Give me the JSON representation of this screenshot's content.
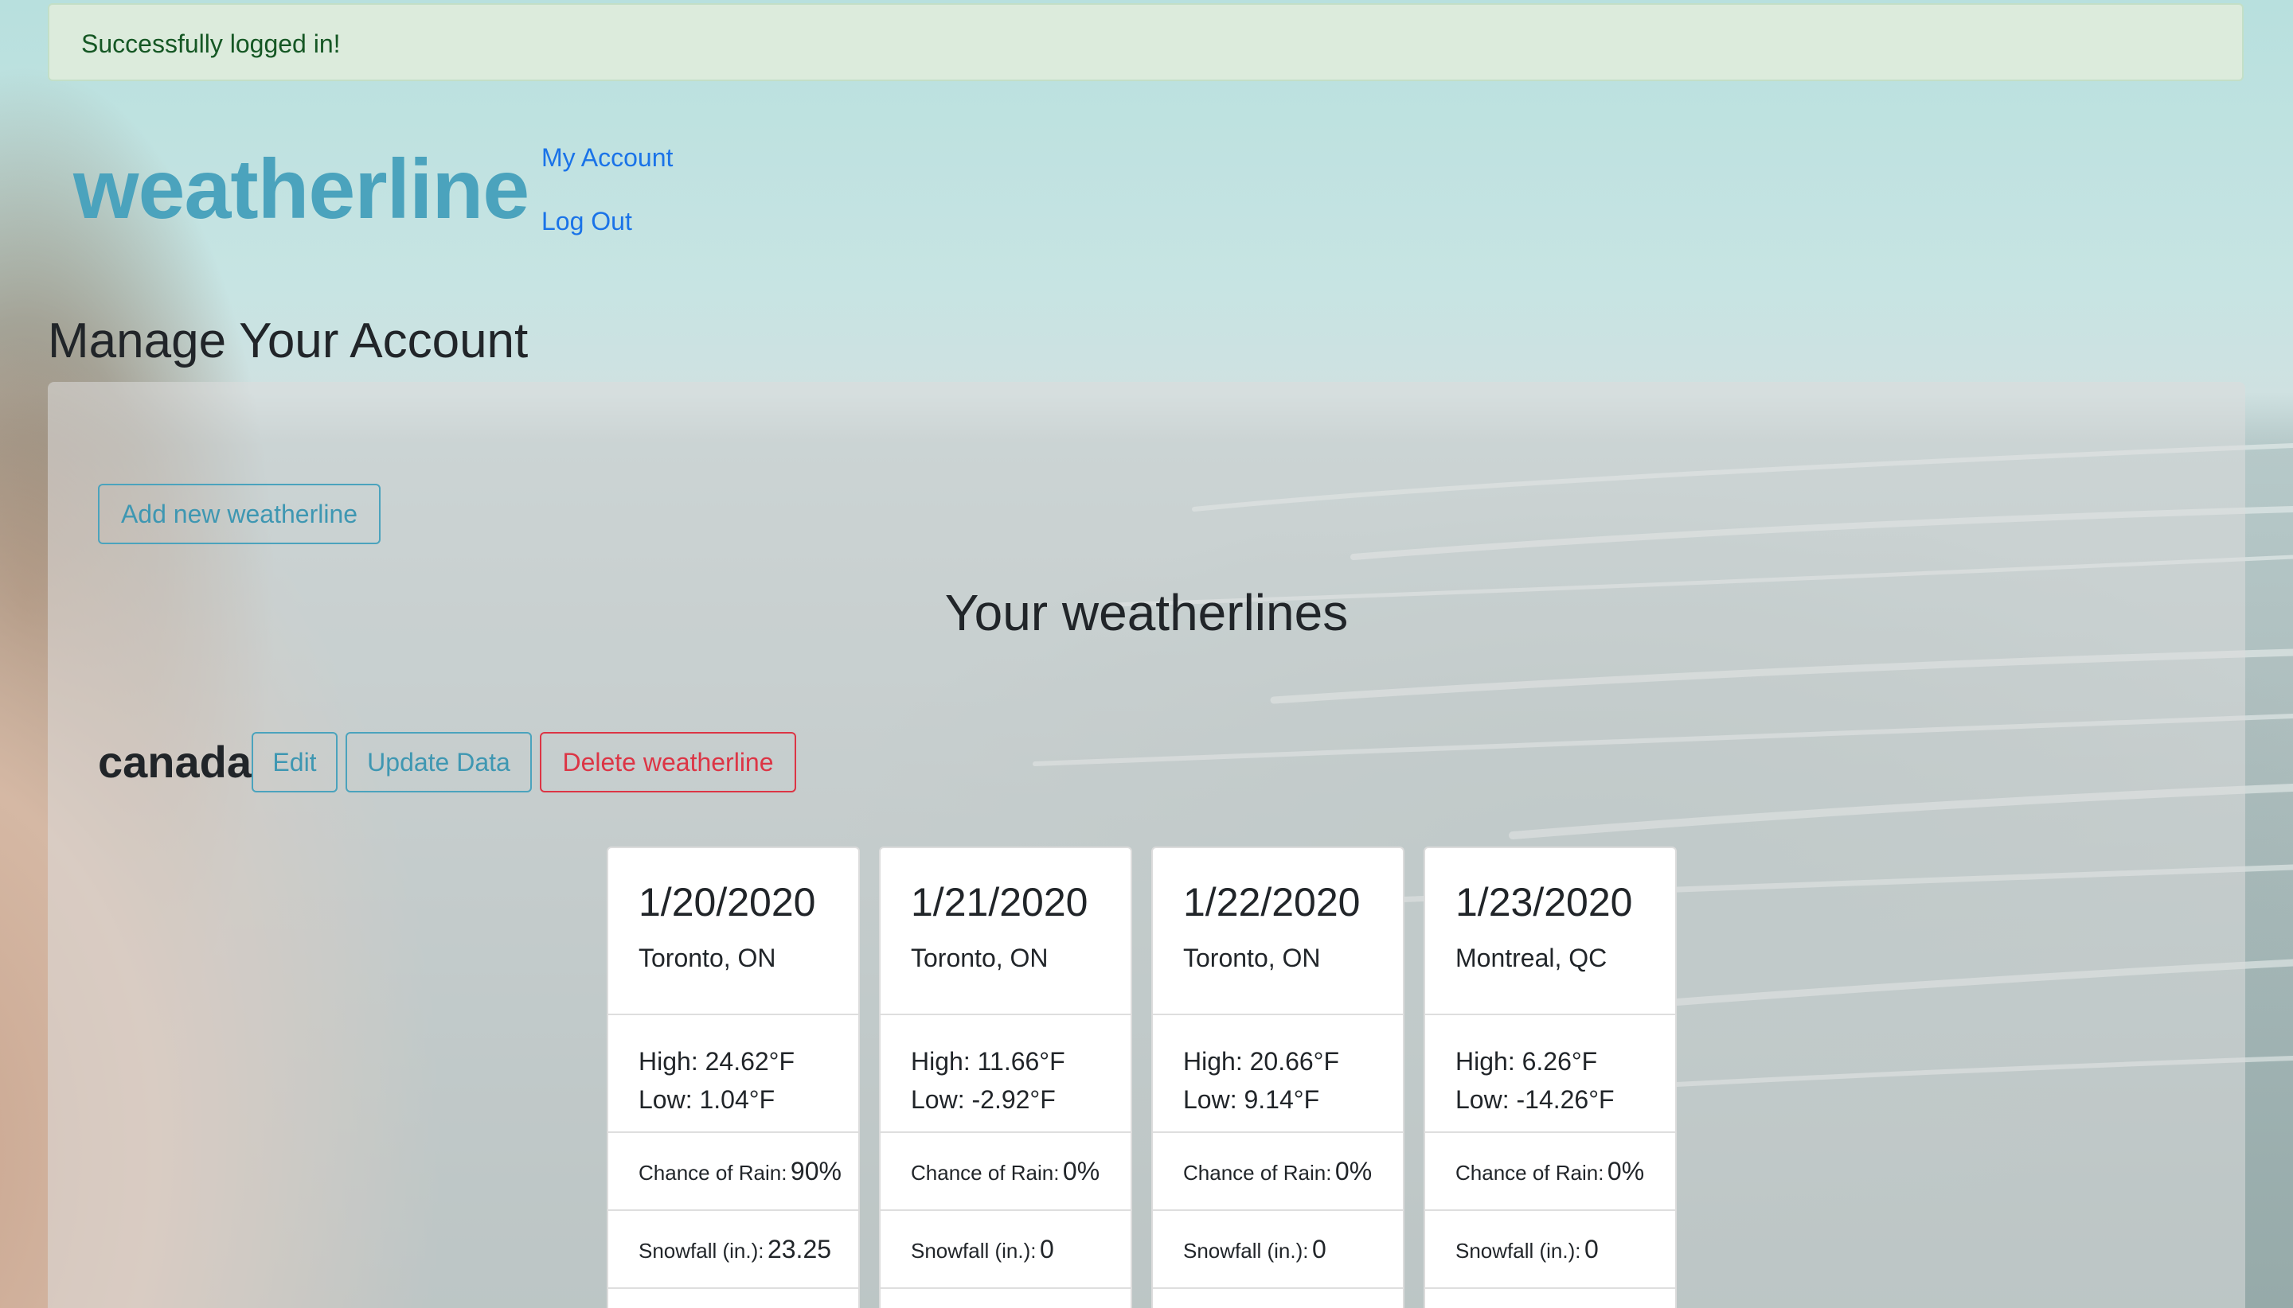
{
  "alert": {
    "message": "Successfully logged in!"
  },
  "brand": {
    "name": "weatherline"
  },
  "nav": {
    "my_account": "My Account",
    "log_out": "Log Out"
  },
  "page": {
    "title": "Manage Your Account"
  },
  "actions": {
    "add_new": "Add new weatherline"
  },
  "section": {
    "title": "Your weatherlines"
  },
  "weatherline": {
    "name": "canada",
    "edit_label": "Edit",
    "update_label": "Update Data",
    "delete_label": "Delete weatherline",
    "labels": {
      "high": "High:",
      "low": "Low:",
      "rain": "Chance of Rain:",
      "snow": "Snowfall (in.):"
    },
    "days": [
      {
        "date": "1/20/2020",
        "location": "Toronto, ON",
        "high": "24.62°F",
        "low": "1.04°F",
        "rain": "90%",
        "snow": "23.25"
      },
      {
        "date": "1/21/2020",
        "location": "Toronto, ON",
        "high": "11.66°F",
        "low": "-2.92°F",
        "rain": "0%",
        "snow": "0"
      },
      {
        "date": "1/22/2020",
        "location": "Toronto, ON",
        "high": "20.66°F",
        "low": "9.14°F",
        "rain": "0%",
        "snow": "0"
      },
      {
        "date": "1/23/2020",
        "location": "Montreal, QC",
        "high": "6.26°F",
        "low": "-14.26°F",
        "rain": "0%",
        "snow": "0"
      }
    ]
  }
}
